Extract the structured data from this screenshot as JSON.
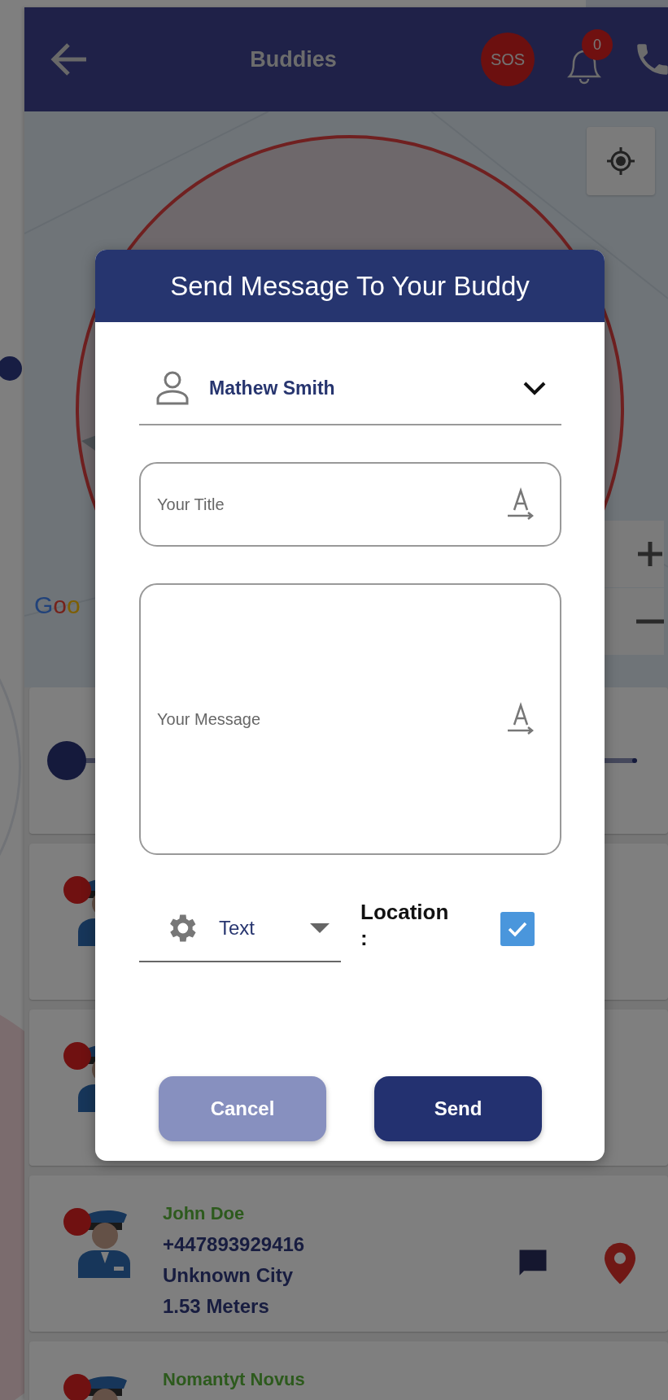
{
  "app_bar": {
    "title": "Buddies",
    "sos": "SOS",
    "notification_count": "0"
  },
  "map": {
    "attribution": "Goo"
  },
  "radius_slider": {
    "level": 0
  },
  "buddies": [
    {
      "kind": "covered"
    },
    {
      "kind": "covered"
    },
    {
      "kind": "full",
      "name": "John Doe",
      "phone": "+447893929416",
      "city": "Unknown City",
      "distance": "1.53 Meters"
    },
    {
      "kind": "full",
      "name": "Nomantyt Novus"
    }
  ],
  "dialog": {
    "title": "Send Message To Your Buddy",
    "recipient": "Mathew Smith",
    "title_field": {
      "placeholder": "Your Title"
    },
    "message_field": {
      "placeholder": "Your Message"
    },
    "type_select": {
      "value": "Text"
    },
    "location": {
      "label": "Location :",
      "checked": true
    },
    "buttons": [
      {
        "label": "Cancel",
        "kind": "secondary"
      },
      {
        "label": "Send",
        "kind": "primary"
      }
    ]
  }
}
